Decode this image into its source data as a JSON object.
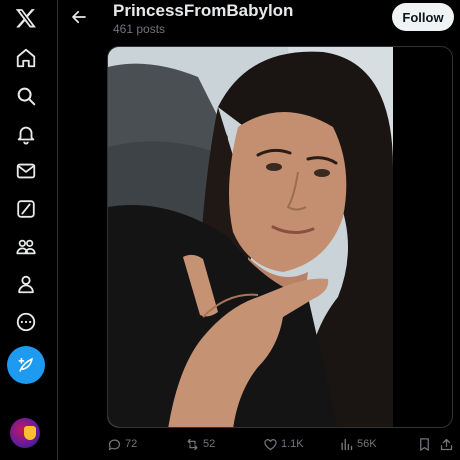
{
  "header": {
    "title": "PrincessFromBabylon",
    "subtitle": "461 posts",
    "follow_label": "Follow"
  },
  "nav": {
    "items": [
      {
        "icon": "x-logo-icon"
      },
      {
        "icon": "home-icon"
      },
      {
        "icon": "search-icon"
      },
      {
        "icon": "bell-icon"
      },
      {
        "icon": "mail-icon"
      },
      {
        "icon": "grok-icon"
      },
      {
        "icon": "communities-icon"
      },
      {
        "icon": "profile-icon"
      },
      {
        "icon": "more-icon"
      }
    ],
    "compose_icon": "compose-icon"
  },
  "media": {
    "alt_visible": false
  },
  "actions": {
    "replies": "72",
    "reposts": "52",
    "likes": "1.1K",
    "views": "56K"
  },
  "colors": {
    "background": "#000000",
    "accent": "#1d9bf0",
    "muted": "#71767b",
    "text": "#e7e9ea"
  }
}
